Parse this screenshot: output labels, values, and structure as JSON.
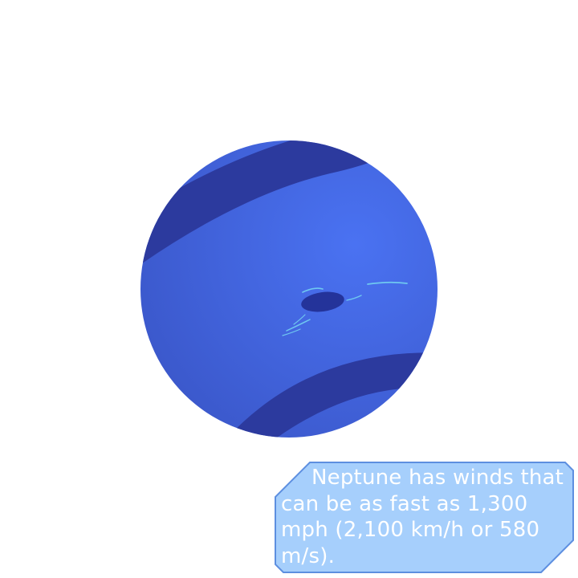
{
  "colors": {
    "background": "#ffffff",
    "planet_light": "#4a72f2",
    "planet_dark": "#3a5bd0",
    "band": "#2c3a9e",
    "storm": "#24339a",
    "cloud_streak": "#6fc8f0",
    "callout_fill": "#a6cffc",
    "callout_border": "#5d8fe0",
    "callout_text": "#ffffff"
  },
  "icons": [
    "neptune-planet",
    "great-dark-spot"
  ],
  "fact": {
    "text": "Neptune has winds that can be as fast as 1,300 mph (2,100 km/h or 580 m/s)."
  }
}
